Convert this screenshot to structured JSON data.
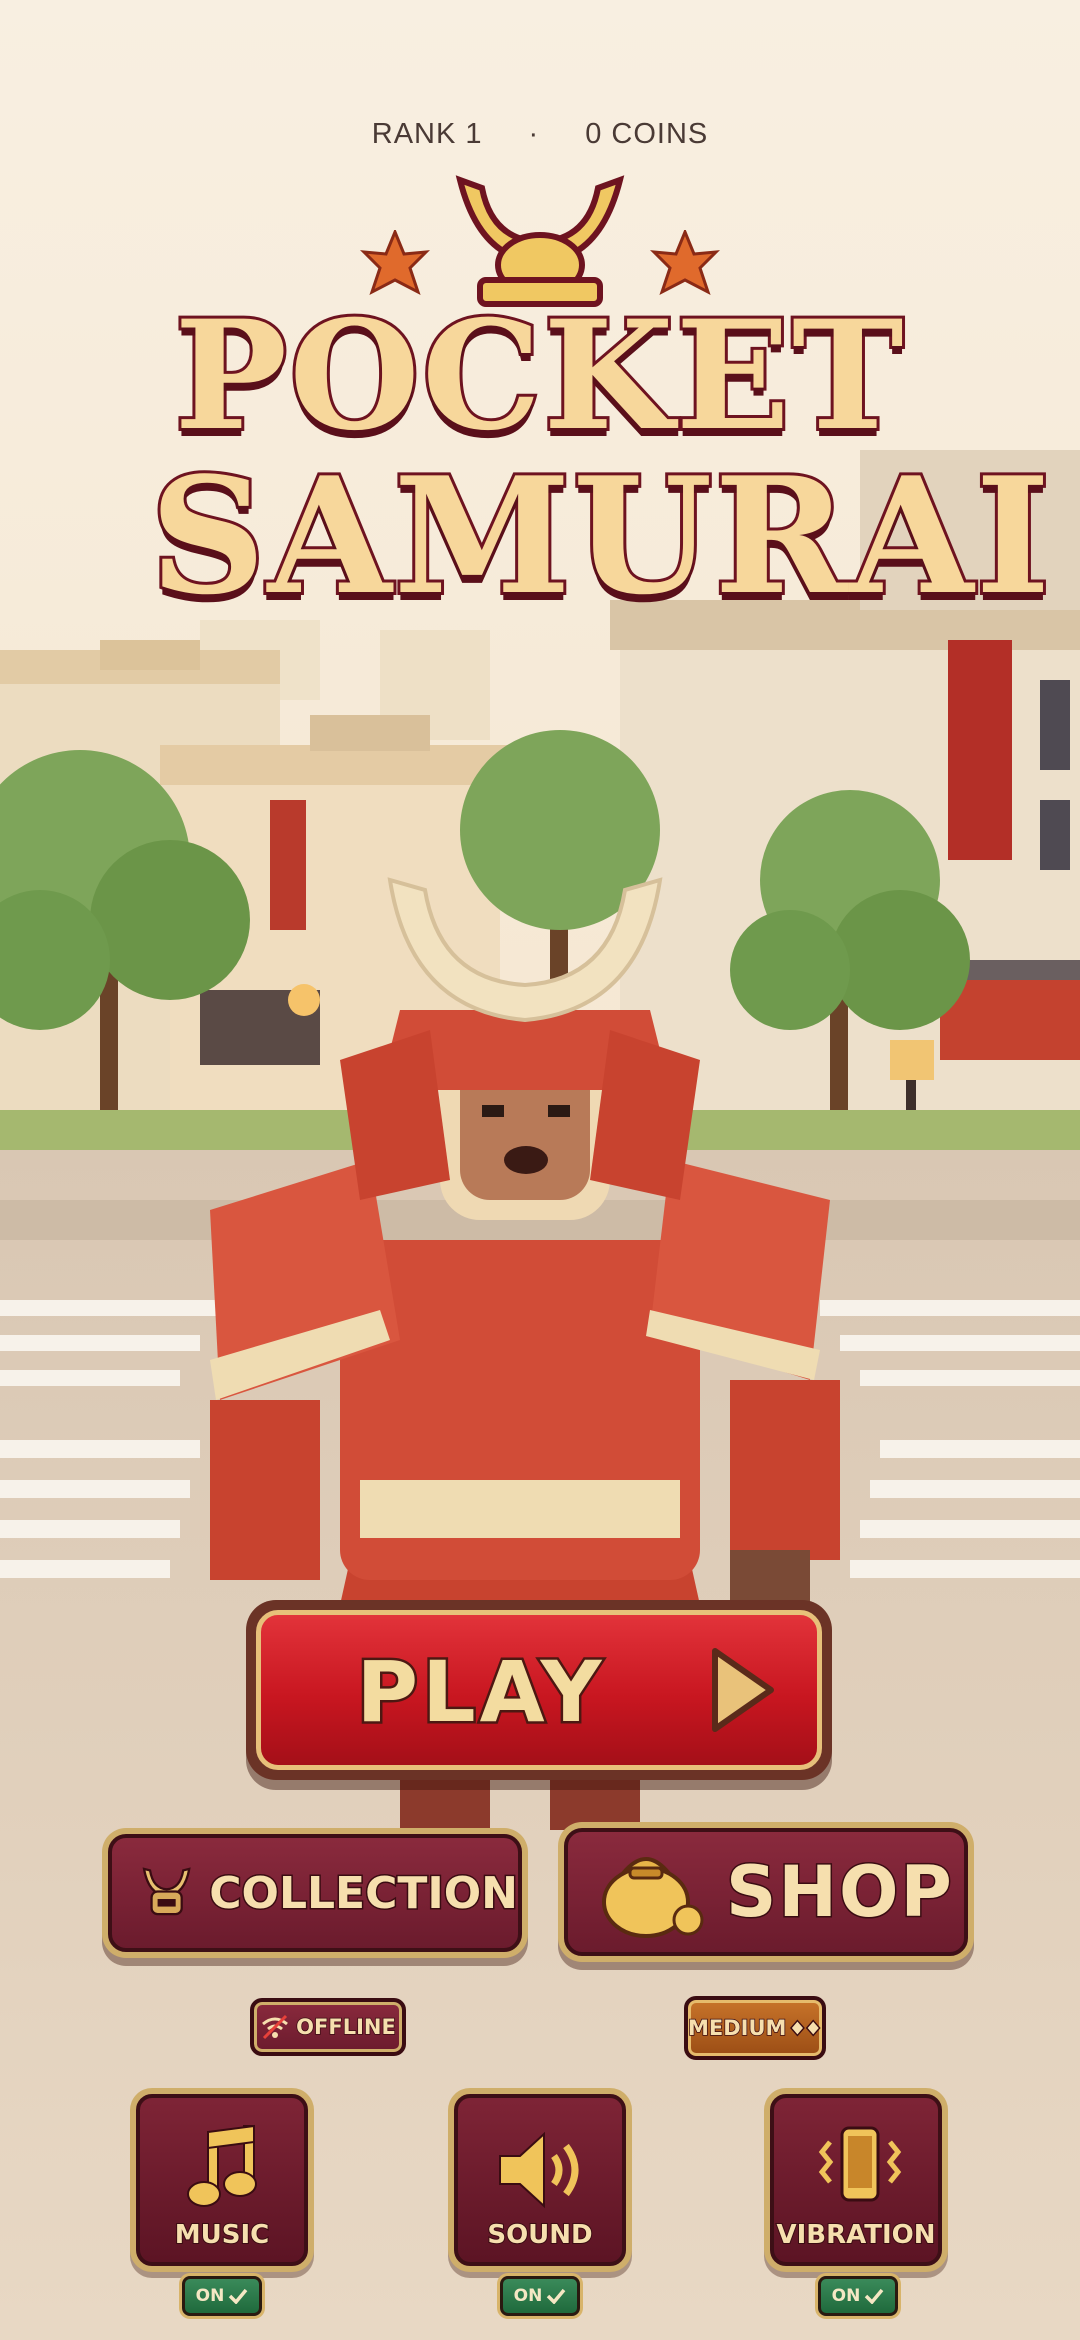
{
  "status": {
    "rank": "RANK 1",
    "separator": "·",
    "coins": "0 COINS"
  },
  "logo": {
    "line1": "POCKET",
    "line2": "SAMURAI"
  },
  "buttons": {
    "play": "PLAY",
    "collection": "COLLECTION",
    "shop": "SHOP"
  },
  "pills": {
    "offline": "OFFLINE",
    "difficulty": "MEDIUM"
  },
  "toggles": [
    {
      "label": "MUSIC",
      "state": "ON",
      "icon": "music-note-icon"
    },
    {
      "label": "SOUND",
      "state": "ON",
      "icon": "speaker-icon"
    },
    {
      "label": "VIBRATION",
      "state": "ON",
      "icon": "phone-vibration-icon"
    }
  ],
  "colors": {
    "primary_red": "#c81620",
    "maroon": "#6b1b2d",
    "gold": "#cfae6a",
    "cream_text": "#f6dfae",
    "on_green": "#2a7a4a"
  }
}
